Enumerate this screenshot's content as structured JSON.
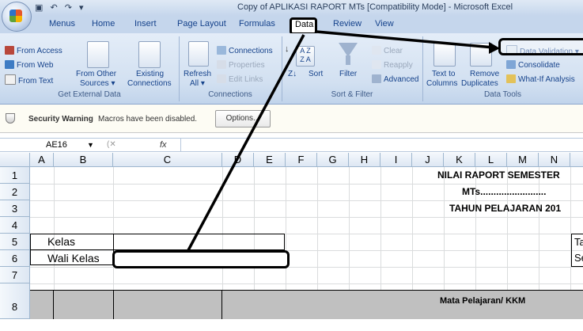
{
  "window": {
    "title": "Copy of APLIKASI RAPORT MTs  [Compatibility Mode] - Microsoft Excel",
    "qat": "▣ ↶ ↷ ▾"
  },
  "tabs": [
    "Menus",
    "Home",
    "Insert",
    "Page Layout",
    "Formulas",
    "Data",
    "Review",
    "View"
  ],
  "ribbon": {
    "get_external": {
      "from_access": "From Access",
      "from_web": "From Web",
      "from_text": "From Text",
      "from_other": "From Other",
      "from_other2": "Sources ▾",
      "existing": "Existing",
      "existing2": "Connections",
      "label": "Get External Data"
    },
    "connections": {
      "refresh": "Refresh",
      "refresh2": "All ▾",
      "connections": "Connections",
      "properties": "Properties",
      "edit_links": "Edit Links",
      "label": "Connections"
    },
    "sort_filter": {
      "sort": "Sort",
      "filter": "Filter",
      "clear": "Clear",
      "reapply": "Reapply",
      "advanced": "Advanced",
      "label": "Sort & Filter"
    },
    "data_tools": {
      "text_to": "Text to",
      "columns": "Columns",
      "remove": "Remove",
      "duplicates": "Duplicates",
      "data_validation": "Data Validation",
      "consolidate": "Consolidate",
      "whatif": "What-If Analysis",
      "label": "Data Tools"
    }
  },
  "security": {
    "title": "Security Warning",
    "message": "Macros have been disabled.",
    "options": "Options..."
  },
  "formula_bar": {
    "name_box": "AE16",
    "fx": "fx",
    "value": ""
  },
  "columns": [
    "A",
    "B",
    "C",
    "D",
    "E",
    "F",
    "G",
    "H",
    "I",
    "J",
    "K",
    "L",
    "M",
    "N"
  ],
  "rows": [
    "1",
    "2",
    "3",
    "4",
    "5",
    "6",
    "7",
    "8"
  ],
  "cells": {
    "r1": "NILAI RAPORT SEMESTER",
    "r2": "MTs.........................",
    "r3": "TAHUN PELAJARAN 201",
    "kelas": "Kelas",
    "wali_kelas": "Wali Kelas",
    "n5": "Ta",
    "n6": "Se",
    "r8": "Mata Pelajaran/ KKM"
  },
  "colors": {
    "ribbon": "#d2e0f1",
    "header_fill": "#c0c0c0",
    "annotation": "#000000"
  }
}
